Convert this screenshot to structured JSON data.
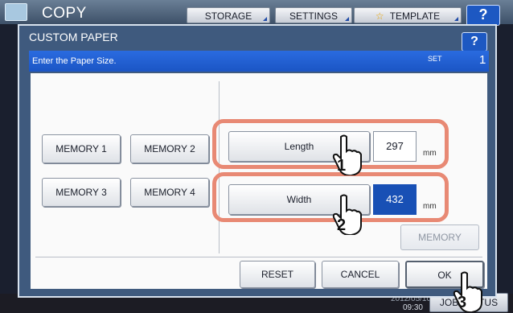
{
  "background": {
    "app_title": "COPY",
    "toolbar": {
      "storage": "STORAGE",
      "settings": "SETTINGS",
      "template": "TEMPLATE",
      "help": "?"
    },
    "bottom": {
      "clock_date": "2012/05/10",
      "clock_time": "09:30",
      "job_button": "JOB STATUS"
    }
  },
  "dialog": {
    "title": "CUSTOM PAPER",
    "help": "?",
    "message": "Enter the Paper Size.",
    "set_label": "SET",
    "set_number": "1",
    "memory_buttons": [
      "MEMORY 1",
      "MEMORY 2",
      "MEMORY 3",
      "MEMORY 4"
    ],
    "length": {
      "label": "Length",
      "value": "297",
      "unit": "mm"
    },
    "width": {
      "label": "Width",
      "value": "432",
      "unit": "mm"
    },
    "memory_store": "MEMORY",
    "footer": {
      "reset": "RESET",
      "cancel": "CANCEL",
      "ok": "OK"
    }
  },
  "steps": [
    "1",
    "2",
    "3"
  ],
  "colors": {
    "callout": "#e88974",
    "title_bar": "#1b55c4",
    "active_field": "#1850b5"
  }
}
